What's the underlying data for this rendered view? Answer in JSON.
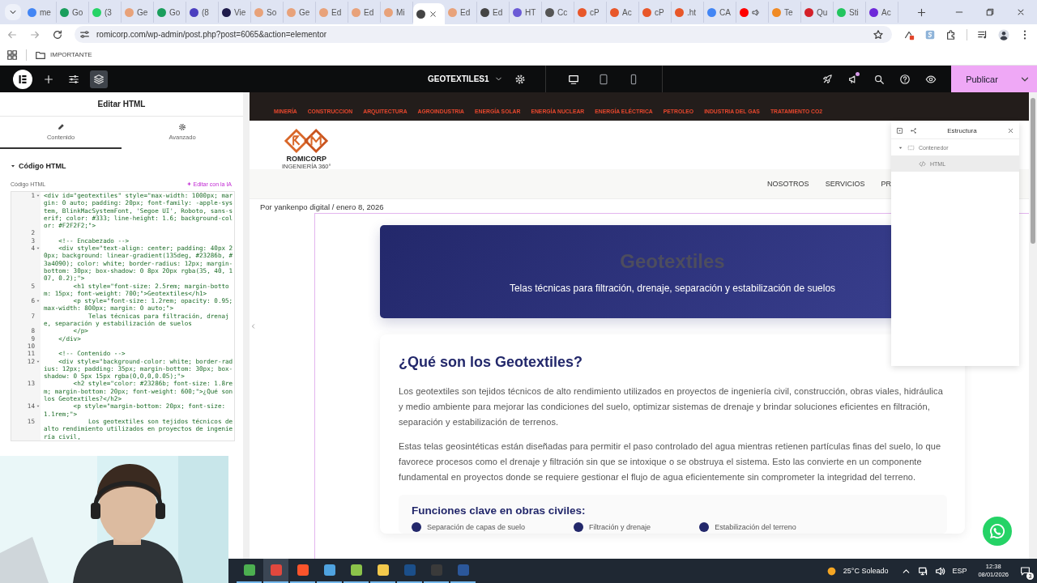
{
  "browser": {
    "tabs": [
      {
        "label": "me",
        "color": "#4285f4",
        "selected": false
      },
      {
        "label": "Go",
        "color": "#1a9e5c",
        "selected": false
      },
      {
        "label": "(3",
        "color": "#25d366",
        "selected": false
      },
      {
        "label": "Ge",
        "color": "#e8a27a",
        "selected": false
      },
      {
        "label": "Go",
        "color": "#1a9e5c",
        "selected": false
      },
      {
        "label": "(8",
        "color": "#4b3fc0",
        "selected": false
      },
      {
        "label": "Vie",
        "color": "#1e1b4b",
        "selected": false
      },
      {
        "label": "So",
        "color": "#e8a27a",
        "selected": false
      },
      {
        "label": "Ge",
        "color": "#e8a27a",
        "selected": false
      },
      {
        "label": "Ed",
        "color": "#e8a27a",
        "selected": false
      },
      {
        "label": "Ed",
        "color": "#e8a27a",
        "selected": false
      },
      {
        "label": "Mi",
        "color": "#e8a27a",
        "selected": false
      },
      {
        "color": "#444444",
        "selected": true
      },
      {
        "label": "Ed",
        "color": "#e8a27a",
        "selected": false
      },
      {
        "label": "Ed",
        "color": "#444444",
        "selected": false
      },
      {
        "label": "HT",
        "color": "#6b5bd6",
        "selected": false
      },
      {
        "label": "Cc",
        "color": "#555555",
        "selected": false
      },
      {
        "label": "cP",
        "color": "#e8572a",
        "selected": false
      },
      {
        "label": "Ac",
        "color": "#e8572a",
        "selected": false
      },
      {
        "label": "cP",
        "color": "#e8572a",
        "selected": false
      },
      {
        "label": ".ht",
        "color": "#e8572a",
        "selected": false
      },
      {
        "label": "CA",
        "color": "#4285f4",
        "selected": false
      },
      {
        "color": "#ff0000",
        "selected": false,
        "audio": true
      },
      {
        "label": "Te",
        "color": "#f08a24",
        "selected": false
      },
      {
        "label": "Qu",
        "color": "#d4202a",
        "selected": false
      },
      {
        "label": "Sti",
        "color": "#22c55e",
        "selected": false
      },
      {
        "label": "Ac",
        "color": "#6d28d9",
        "selected": false
      }
    ],
    "url": "romicorp.com/wp-admin/post.php?post=6065&action=elementor",
    "bookmarks": [
      {
        "label": "IMPORTANTE"
      }
    ]
  },
  "editor_bar": {
    "left_tools": [
      {
        "kind": "logo",
        "selected": false
      },
      {
        "kind": "add",
        "selected": false
      },
      {
        "kind": "sliders",
        "selected": false
      },
      {
        "kind": "layers",
        "selected": true
      }
    ],
    "page_title": "GEOTEXTILES1",
    "devices": [
      {
        "kind": "desktop",
        "selected": true
      },
      {
        "kind": "tablet",
        "selected": false
      },
      {
        "kind": "mobile",
        "selected": false
      }
    ],
    "publish": "Publicar"
  },
  "panel": {
    "title": "Editar HTML",
    "tabs": [
      {
        "label": "Contenido",
        "selected": true
      },
      {
        "label": "Avanzado",
        "selected": false
      }
    ],
    "section": {
      "title": "Código HTML",
      "expanded": true
    },
    "field_label": "Código HTML",
    "ai_link": "Editar con la IA",
    "code_lines": [
      {
        "number": "1",
        "code": "<div id=\"geotextiles\" style=\"max-width: 1000px; margin: 0 auto; padding: 20px; font-family: -apple-system, BlinkMacSystemFont, 'Segoe UI', Roboto, sans-serif; color: #333; line-height: 1.6; background-color: #F2F2F2;\">",
        "foldable": true
      },
      {
        "number": "2",
        "foldable": false
      },
      {
        "number": "3",
        "code": "    <!-- Encabezado -->",
        "foldable": false
      },
      {
        "number": "4",
        "code": "    <div style=\"text-align: center; padding: 40px 20px; background: linear-gradient(135deg, #23286b, #3a4090); color: white; border-radius: 12px; margin-bottom: 30px; box-shadow: 0 8px 20px rgba(35, 40, 107, 0.2);\">",
        "foldable": true
      },
      {
        "number": "5",
        "code": "        <h1 style=\"font-size: 2.5rem; margin-bottom: 15px; font-weight: 700;\">Geotextiles</h1>",
        "foldable": false
      },
      {
        "number": "6",
        "code": "        <p style=\"font-size: 1.2rem; opacity: 0.95; max-width: 800px; margin: 0 auto;\">",
        "foldable": true
      },
      {
        "number": "7",
        "code": "            Telas técnicas para filtración, drenaje, separación y estabilización de suelos",
        "foldable": false
      },
      {
        "number": "8",
        "code": "        </p>",
        "foldable": false
      },
      {
        "number": "9",
        "code": "    </div>",
        "foldable": false
      },
      {
        "number": "10",
        "foldable": false
      },
      {
        "number": "11",
        "code": "    <!-- Contenido -->",
        "foldable": false
      },
      {
        "number": "12",
        "code": "    <div style=\"background-color: white; border-radius: 12px; padding: 35px; margin-bottom: 30px; box-shadow: 0 5px 15px rgba(0,0,0,0.05);\">",
        "foldable": true
      },
      {
        "number": "13",
        "code": "        <h2 style=\"color: #23286b; font-size: 1.8rem; margin-bottom: 20px; font-weight: 600;\">¿Qué son los Geotextiles?</h2>",
        "foldable": false
      },
      {
        "number": "14",
        "code": "        <p style=\"margin-bottom: 20px; font-size: 1.1rem;\">",
        "foldable": true
      },
      {
        "number": "15",
        "code": "            Los geotextiles son tejidos técnicos de alto rendimiento utilizados en proyectos de ingeniería civil,",
        "foldable": false
      }
    ]
  },
  "site": {
    "top_links": [
      "MINERÍA",
      "CONSTRUCCION",
      "ARQUITECTURA",
      "AGROINDUSTRIA",
      "ENERGÍA SOLAR",
      "ENERGÍA NUCLEAR",
      "ENERGÍA ELÉCTRICA",
      "PETROLEO",
      "INDUSTRIA DEL GAS",
      "TRATAMIENTO CO2"
    ],
    "logo": {
      "name": "ROMICORP",
      "tagline": "INGENIERÍA 360°"
    },
    "nav": [
      "NOSOTROS",
      "SERVICIOS",
      "PR"
    ],
    "byline": "Por yankenpo digital / enero 8, 2026",
    "banner": {
      "title": "Geotextiles",
      "subtitle": "Telas técnicas para filtración, drenaje, separación y estabilización de suelos"
    },
    "card": {
      "heading": "¿Qué son los Geotextiles?",
      "paragraphs": [
        "Los geotextiles son tejidos técnicos de alto rendimiento utilizados en proyectos de ingeniería civil, construcción, obras viales, hidráulica y medio ambiente para mejorar las condiciones del suelo, optimizar sistemas de drenaje y brindar soluciones eficientes en filtración, separación y estabilización de terrenos.",
        "Estas telas geosintéticas están diseñadas para permitir el paso controlado del agua mientras retienen partículas finas del suelo, lo que favorece procesos como el drenaje y filtración sin que se intoxique o se obstruya el sistema. Esto las convierte en un componente fundamental en proyectos donde se requiere gestionar el flujo de agua eficientemente sin comprometer la integridad del terreno."
      ],
      "functions": {
        "heading": "Funciones clave en obras civiles:",
        "items": [
          "Separación de capas de suelo",
          "Filtración y drenaje",
          "Estabilización del terreno"
        ]
      }
    }
  },
  "structure": {
    "title": "Estructura",
    "tree": [
      {
        "label": "Contenedor",
        "kind": "container",
        "expanded": true,
        "selected": false,
        "children": [
          {
            "label": "HTML",
            "kind": "html",
            "selected": true
          }
        ]
      }
    ]
  },
  "taskbar": {
    "apps": [
      {
        "color": "#4caf50",
        "selected": false
      },
      {
        "color": "#e0483e",
        "selected": true
      },
      {
        "color": "#fb542b",
        "selected": false
      },
      {
        "color": "#4fa3e0",
        "selected": false
      },
      {
        "color": "#8bc34a",
        "selected": false
      },
      {
        "color": "#f2c94c",
        "selected": false
      },
      {
        "color": "#1b4f8a",
        "selected": false
      },
      {
        "color": "#3a3a3a",
        "selected": false
      },
      {
        "color": "#2b579a",
        "selected": false
      }
    ],
    "weather": "25°C Soleado",
    "language": "ESP",
    "time": "12:38",
    "date": "08/01/2026",
    "notifications": "3"
  }
}
